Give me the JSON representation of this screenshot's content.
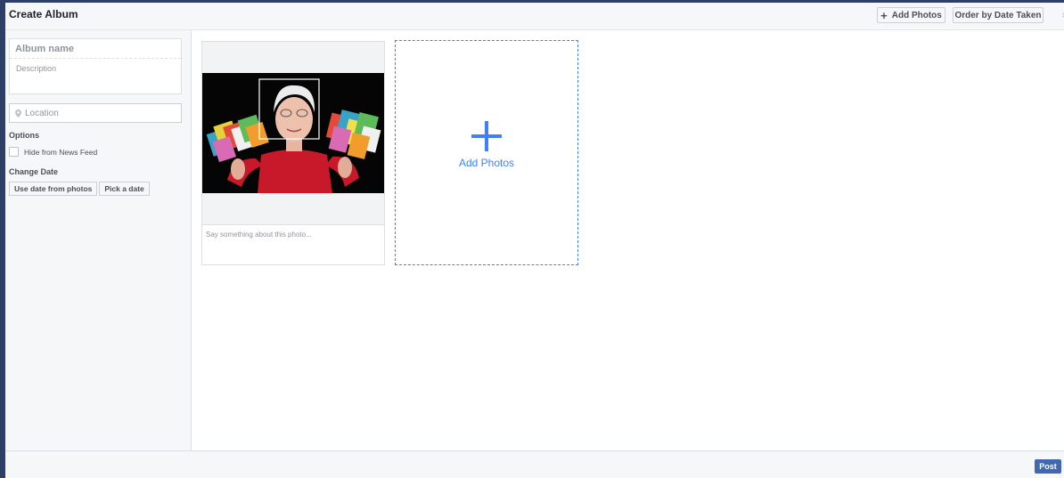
{
  "dialog": {
    "title": "Create Album",
    "add_photos_label": "Add Photos",
    "order_label": "Order by Date Taken",
    "close_glyph": "×"
  },
  "sidebar": {
    "album_name_placeholder": "Album name",
    "description_placeholder": "Description",
    "location_placeholder": "Location",
    "options_heading": "Options",
    "hide_feed_label": "Hide from News Feed",
    "change_date_heading": "Change Date",
    "date_buttons": [
      "Use date from photos",
      "Pick a date"
    ]
  },
  "main": {
    "photo_caption_placeholder": "Say something about this photo...",
    "add_photos_label": "Add Photos"
  },
  "footer": {
    "post_label": "Post"
  },
  "colors": {
    "accent": "#4080ff",
    "post_button": "#4267b2"
  }
}
